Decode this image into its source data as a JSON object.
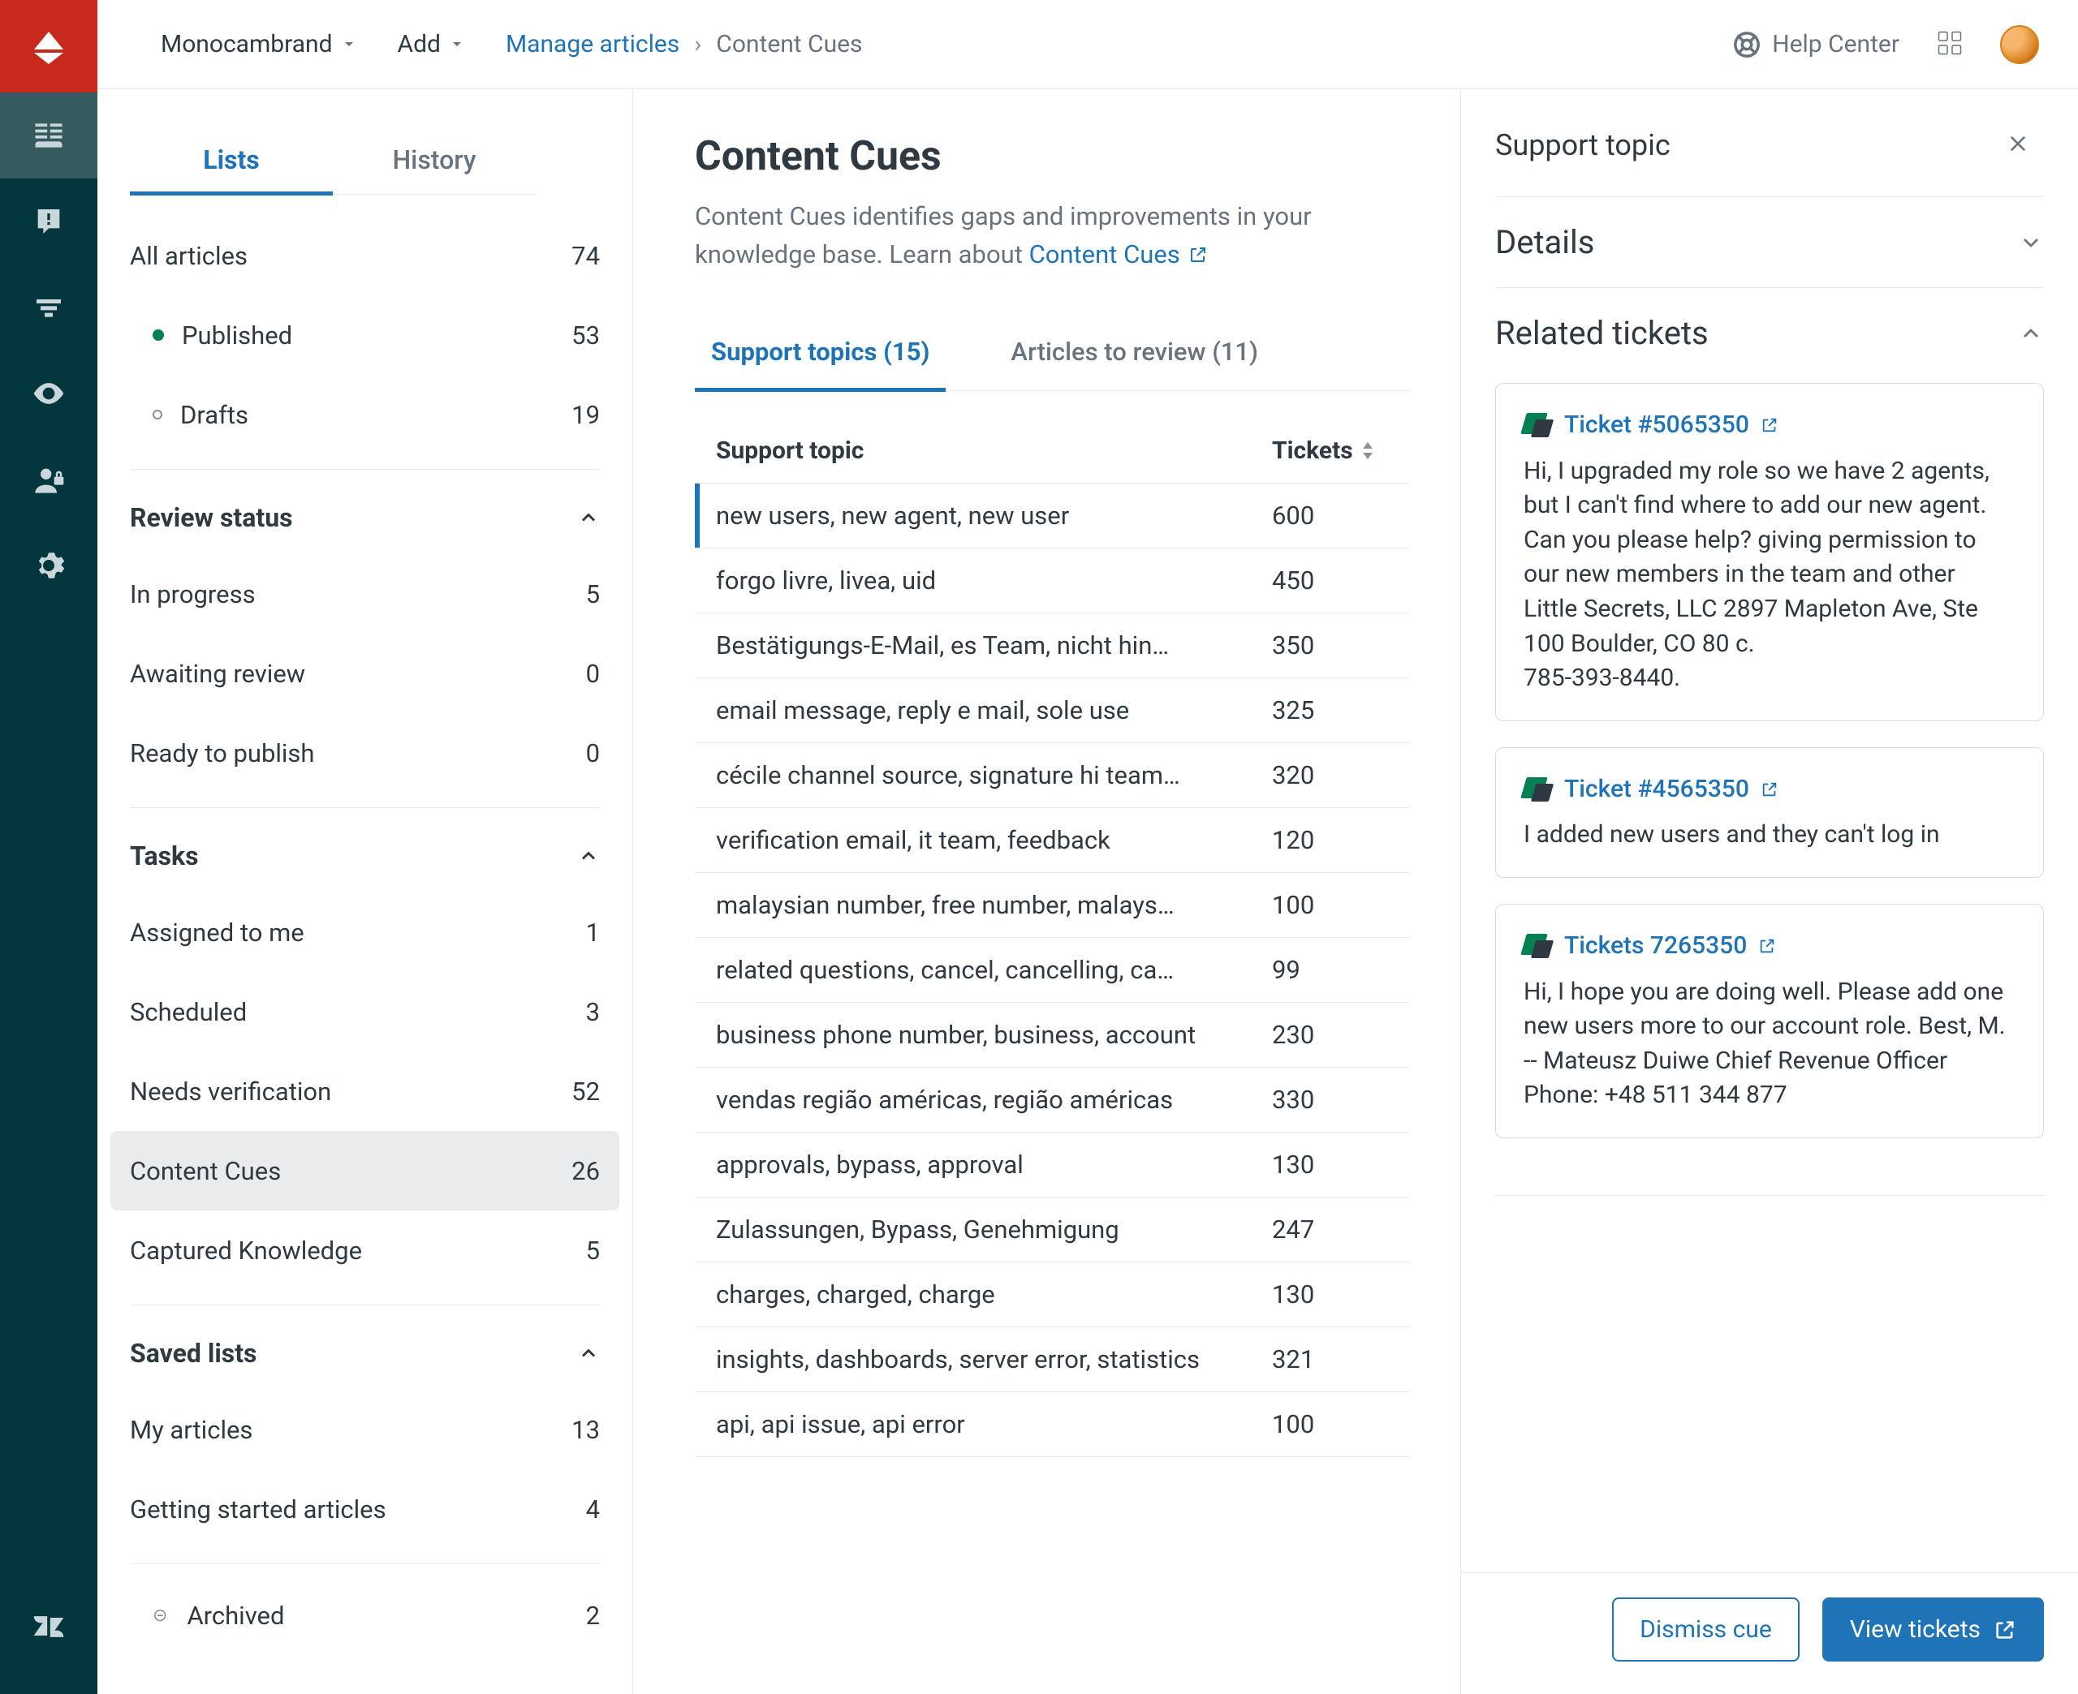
{
  "header": {
    "brand": "Monocambrand",
    "add": "Add",
    "breadcrumb_link": "Manage articles",
    "breadcrumb_current": "Content Cues",
    "help": "Help Center"
  },
  "sidebar": {
    "tabs": {
      "lists": "Lists",
      "history": "History"
    },
    "all": {
      "label": "All articles",
      "count": "74"
    },
    "published": {
      "label": "Published",
      "count": "53"
    },
    "drafts": {
      "label": "Drafts",
      "count": "19"
    },
    "sections": {
      "review": {
        "title": "Review status",
        "items": [
          {
            "label": "In progress",
            "count": "5"
          },
          {
            "label": "Awaiting review",
            "count": "0"
          },
          {
            "label": "Ready to publish",
            "count": "0"
          }
        ]
      },
      "tasks": {
        "title": "Tasks",
        "items": [
          {
            "label": "Assigned to me",
            "count": "1"
          },
          {
            "label": "Scheduled",
            "count": "3"
          },
          {
            "label": "Needs verification",
            "count": "52"
          },
          {
            "label": "Content Cues",
            "count": "26"
          },
          {
            "label": "Captured Knowledge",
            "count": "5"
          }
        ]
      },
      "saved": {
        "title": "Saved lists",
        "items": [
          {
            "label": "My articles",
            "count": "13"
          },
          {
            "label": "Getting started articles",
            "count": "4"
          }
        ]
      }
    },
    "archived": {
      "label": "Archived",
      "count": "2"
    }
  },
  "main": {
    "title": "Content Cues",
    "desc_pre": "Content Cues identifies gaps and improvements in your knowledge base. Learn about ",
    "desc_link": "Content Cues",
    "tabs": {
      "support": "Support topics (15)",
      "review": "Articles to review (11)"
    },
    "table": {
      "head_topic": "Support topic",
      "head_tickets": "Tickets",
      "rows": [
        {
          "topic": "new users, new agent, new user",
          "tickets": "600"
        },
        {
          "topic": "forgo livre, livea, uid",
          "tickets": "450"
        },
        {
          "topic": "Bestätigungs-E-Mail, es Team, nicht hin…",
          "tickets": "350"
        },
        {
          "topic": "email message, reply e mail, sole use",
          "tickets": "325"
        },
        {
          "topic": "cécile channel source, signature hi team…",
          "tickets": "320"
        },
        {
          "topic": "verification email, it team, feedback",
          "tickets": "120"
        },
        {
          "topic": "malaysian number, free number, malays…",
          "tickets": "100"
        },
        {
          "topic": "related questions, cancel, cancelling, ca…",
          "tickets": "99"
        },
        {
          "topic": "business phone number, business, account",
          "tickets": "230"
        },
        {
          "topic": "vendas região américas, região américas",
          "tickets": "330"
        },
        {
          "topic": "approvals, bypass, approval",
          "tickets": "130"
        },
        {
          "topic": "Zulassungen, Bypass, Genehmigung",
          "tickets": "247"
        },
        {
          "topic": "charges, charged, charge",
          "tickets": "130"
        },
        {
          "topic": "insights, dashboards, server error, statistics",
          "tickets": "321"
        },
        {
          "topic": "api, api issue, api error",
          "tickets": "100"
        }
      ]
    }
  },
  "detail": {
    "title": "Support topic",
    "sections": {
      "details": "Details",
      "related": "Related tickets"
    },
    "tickets": [
      {
        "link": "Ticket #5065350",
        "body": "Hi, I upgraded my role so we have 2 agents, but I can't find where to add our new agent. Can you please help? giving permission  to our new members in the team and other\nLittle Secrets, LLC 2897 Mapleton Ave, Ste 100 Boulder, CO 80 c.\n785-393-8440."
      },
      {
        "link": "Ticket #4565350",
        "body": "I added new users and they can't log in"
      },
      {
        "link": "Tickets 7265350",
        "body": "Hi, I hope you are doing well. Please add one new users  more to our account role. Best, M. -- Mateusz Duiwe Chief Revenue Officer Phone: +48 511 344 877"
      }
    ],
    "footer": {
      "dismiss": "Dismiss cue",
      "view": "View tickets"
    }
  }
}
